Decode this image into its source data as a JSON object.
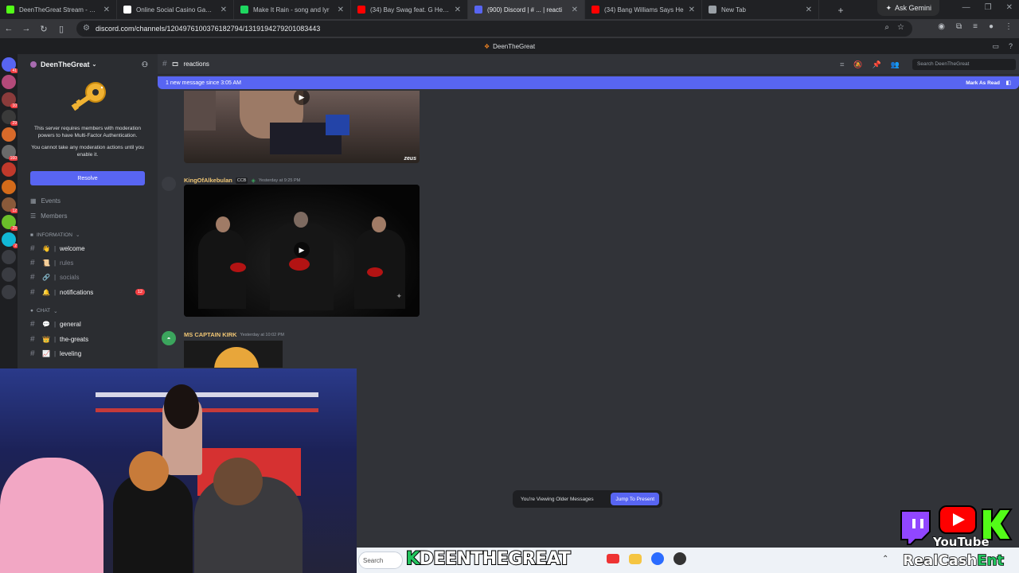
{
  "browser": {
    "tabs": [
      {
        "title": "DeenTheGreat Stream - Wa",
        "color": "#53fc18"
      },
      {
        "title": "Online Social Casino Games",
        "color": "#ffffff"
      },
      {
        "title": "Make It Rain - song and lyr",
        "color": "#1ed760"
      },
      {
        "title": "(34) Bay Swag feat. G Herbo",
        "color": "#ff0000"
      },
      {
        "title": "(900) Discord | # ... | reacti",
        "color": "#5865f2"
      },
      {
        "title": "(34) Bang Williams Says He",
        "color": "#ff0000"
      },
      {
        "title": "New Tab",
        "color": "#9aa0a6"
      }
    ],
    "active_tab_index": 4,
    "ask_gemini": "Ask Gemini",
    "url": "discord.com/channels/1204976100376182794/1319194279201083443"
  },
  "discord": {
    "window_title": "DeenTheGreat",
    "server_name": "DeenTheGreat",
    "mfa": {
      "text1": "This server requires members with moderation powers to have Multi-Factor Authentication.",
      "text2": "You cannot take any moderation actions until you enable it.",
      "resolve": "Resolve"
    },
    "links": [
      "Events",
      "Members"
    ],
    "categories": {
      "information": "INFORMATION",
      "chat": "CHAT"
    },
    "info_channels": [
      {
        "name": "welcome",
        "emoji": "👋",
        "state": "bright"
      },
      {
        "name": "rules",
        "emoji": "📜",
        "state": "dim"
      },
      {
        "name": "socials",
        "emoji": "🔗",
        "state": "dim"
      },
      {
        "name": "notifications",
        "emoji": "🔔",
        "state": "bright",
        "badge": "12"
      }
    ],
    "chat_channels": [
      {
        "name": "general",
        "emoji": "💬",
        "state": "bright"
      },
      {
        "name": "the-greats",
        "emoji": "👑",
        "state": "bright"
      },
      {
        "name": "leveling",
        "emoji": "📈",
        "state": "bright"
      }
    ],
    "channel_name": "reactions",
    "search_placeholder": "Search DeenTheGreat",
    "new_messages": "1 new message since 3:05 AM",
    "mark_as_read": "Mark As Read",
    "messages": [
      {
        "username": "KingOfAlkebulan",
        "tag": "CCB",
        "timestamp": "Yesterday at 9:25 PM"
      },
      {
        "username": "MS CAPTAIN KIRK",
        "timestamp": "Yesterday at 10:02 PM"
      }
    ],
    "video_watermark": "zeus",
    "older_notice": "You're Viewing Older Messages",
    "jump_to_present": "Jump To Present",
    "server_badges": [
      "41",
      "",
      "10",
      "29",
      "",
      "160",
      "",
      "",
      "12",
      "25",
      "2"
    ]
  },
  "taskbar": {
    "search": "Search",
    "banner_prefix": "K",
    "banner": "DEENTHEGREAT"
  },
  "overlay": {
    "youtube": "YouTube",
    "realcash_a": "RealCash",
    "realcash_b": "Ent"
  }
}
